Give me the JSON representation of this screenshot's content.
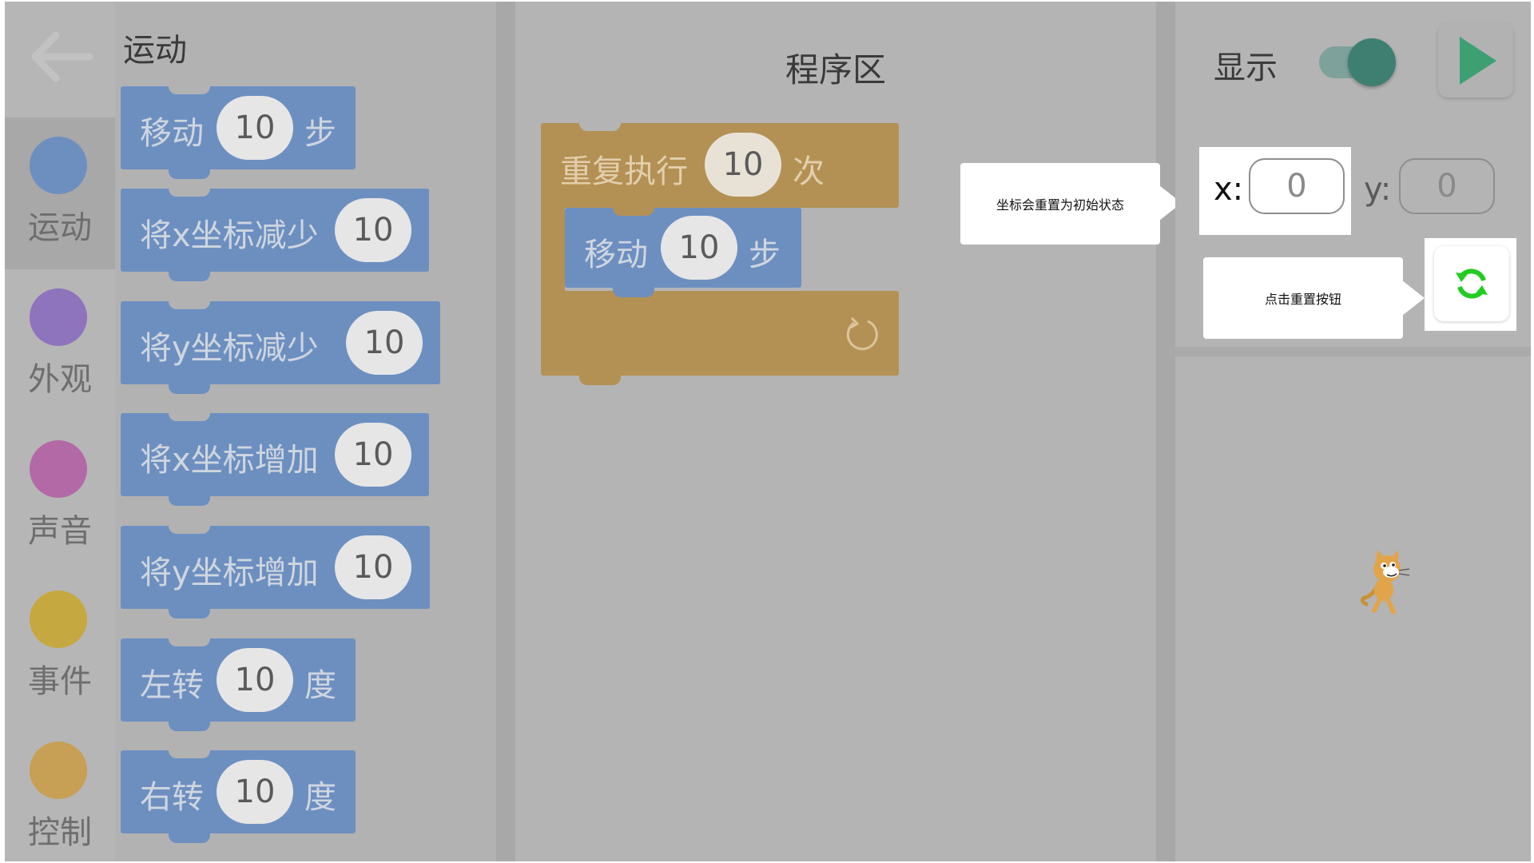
{
  "colors": {
    "motion": "#6d8fc0",
    "looks": "#8e73bd",
    "sound": "#b269a6",
    "events": "#c6a841",
    "control": "#c79f55",
    "orange_block": "#b39154",
    "toggle_knob": "#3f7f72",
    "play": "#3ea072",
    "reset_icon": "#22cc22"
  },
  "sidebar": {
    "back_icon": "arrow-left-icon",
    "categories": [
      {
        "label": "运动"
      },
      {
        "label": "外观"
      },
      {
        "label": "声音"
      },
      {
        "label": "事件"
      },
      {
        "label": "控制"
      }
    ]
  },
  "palette": {
    "title": "运动",
    "blocks": [
      {
        "prefix": "移动",
        "value": "10",
        "suffix": "步"
      },
      {
        "prefix": "将x坐标减少",
        "value": "10",
        "suffix": ""
      },
      {
        "prefix": "将y坐标减少",
        "value": "10",
        "suffix": ""
      },
      {
        "prefix": "将x坐标增加",
        "value": "10",
        "suffix": ""
      },
      {
        "prefix": "将y坐标增加",
        "value": "10",
        "suffix": ""
      },
      {
        "prefix": "左转",
        "value": "10",
        "suffix": "度"
      },
      {
        "prefix": "右转",
        "value": "10",
        "suffix": "度"
      }
    ]
  },
  "program": {
    "title": "程序区",
    "repeat": {
      "prefix": "重复执行",
      "value": "10",
      "suffix": "次"
    },
    "inner": {
      "prefix": "移动",
      "value": "10",
      "suffix": "步"
    }
  },
  "stage": {
    "show_label": "显示",
    "toggle_on": true,
    "x_label": "x:",
    "x_value": "0",
    "y_label": "y:",
    "y_value": "0"
  },
  "tooltips": {
    "coords": "坐标会重置为初始状态",
    "reset": "点击重置按钮"
  }
}
